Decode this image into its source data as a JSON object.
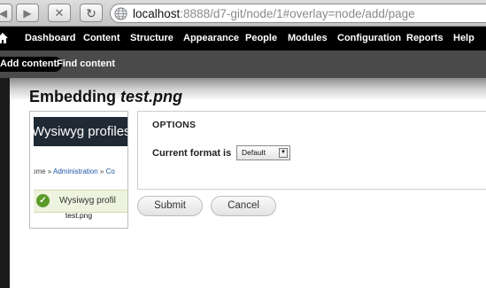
{
  "browser": {
    "url_host": "localhost",
    "url_rest": ":8888/d7-git/node/1#overlay=node/add/page"
  },
  "toolbar": {
    "items": [
      "Dashboard",
      "Content",
      "Structure",
      "Appearance",
      "People",
      "Modules",
      "Configuration",
      "Reports",
      "Help"
    ]
  },
  "shortcuts": {
    "active": "Add content",
    "items": [
      "Find content"
    ]
  },
  "dialog": {
    "title_prefix": "Embedding ",
    "title_file": "test.png",
    "thumbnail": {
      "banner_text": "Wysiwyg profiles",
      "breadcrumb_start": "ome » ",
      "breadcrumb_link1": "Administration",
      "breadcrumb_sep": " » ",
      "breadcrumb_link2": "Co",
      "status_text": "Wysiwyg profil",
      "caption": "test.png"
    },
    "options": {
      "legend": "OPTIONS",
      "format_label": "Current format is",
      "format_value": "Default"
    },
    "buttons": {
      "submit": "Submit",
      "cancel": "Cancel"
    }
  }
}
